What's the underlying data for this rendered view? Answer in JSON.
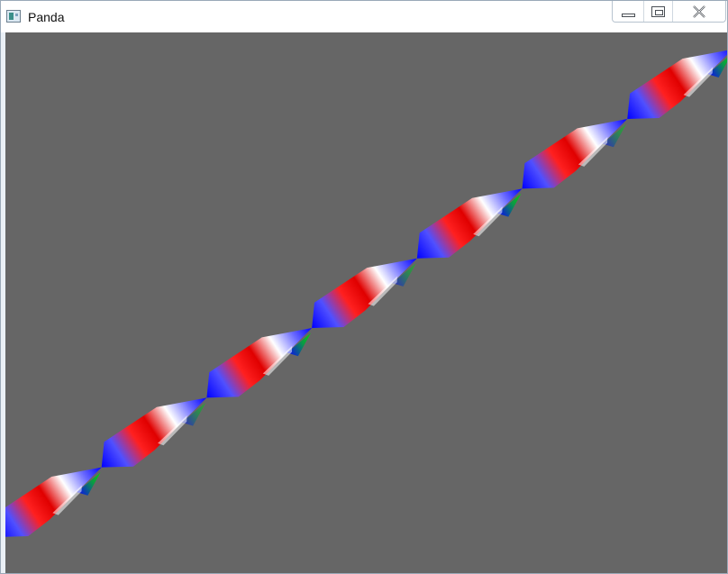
{
  "window": {
    "title": "Panda",
    "app_icon": "window-app-icon",
    "controls": {
      "minimize_icon": "minimize-icon",
      "maximize_icon": "maximize-icon",
      "close_icon": "close-icon"
    }
  },
  "viewport": {
    "background_color": "#666666",
    "ribbon_colors": [
      "#ff0000",
      "#ffffff",
      "#0000ff",
      "#00c800"
    ]
  }
}
